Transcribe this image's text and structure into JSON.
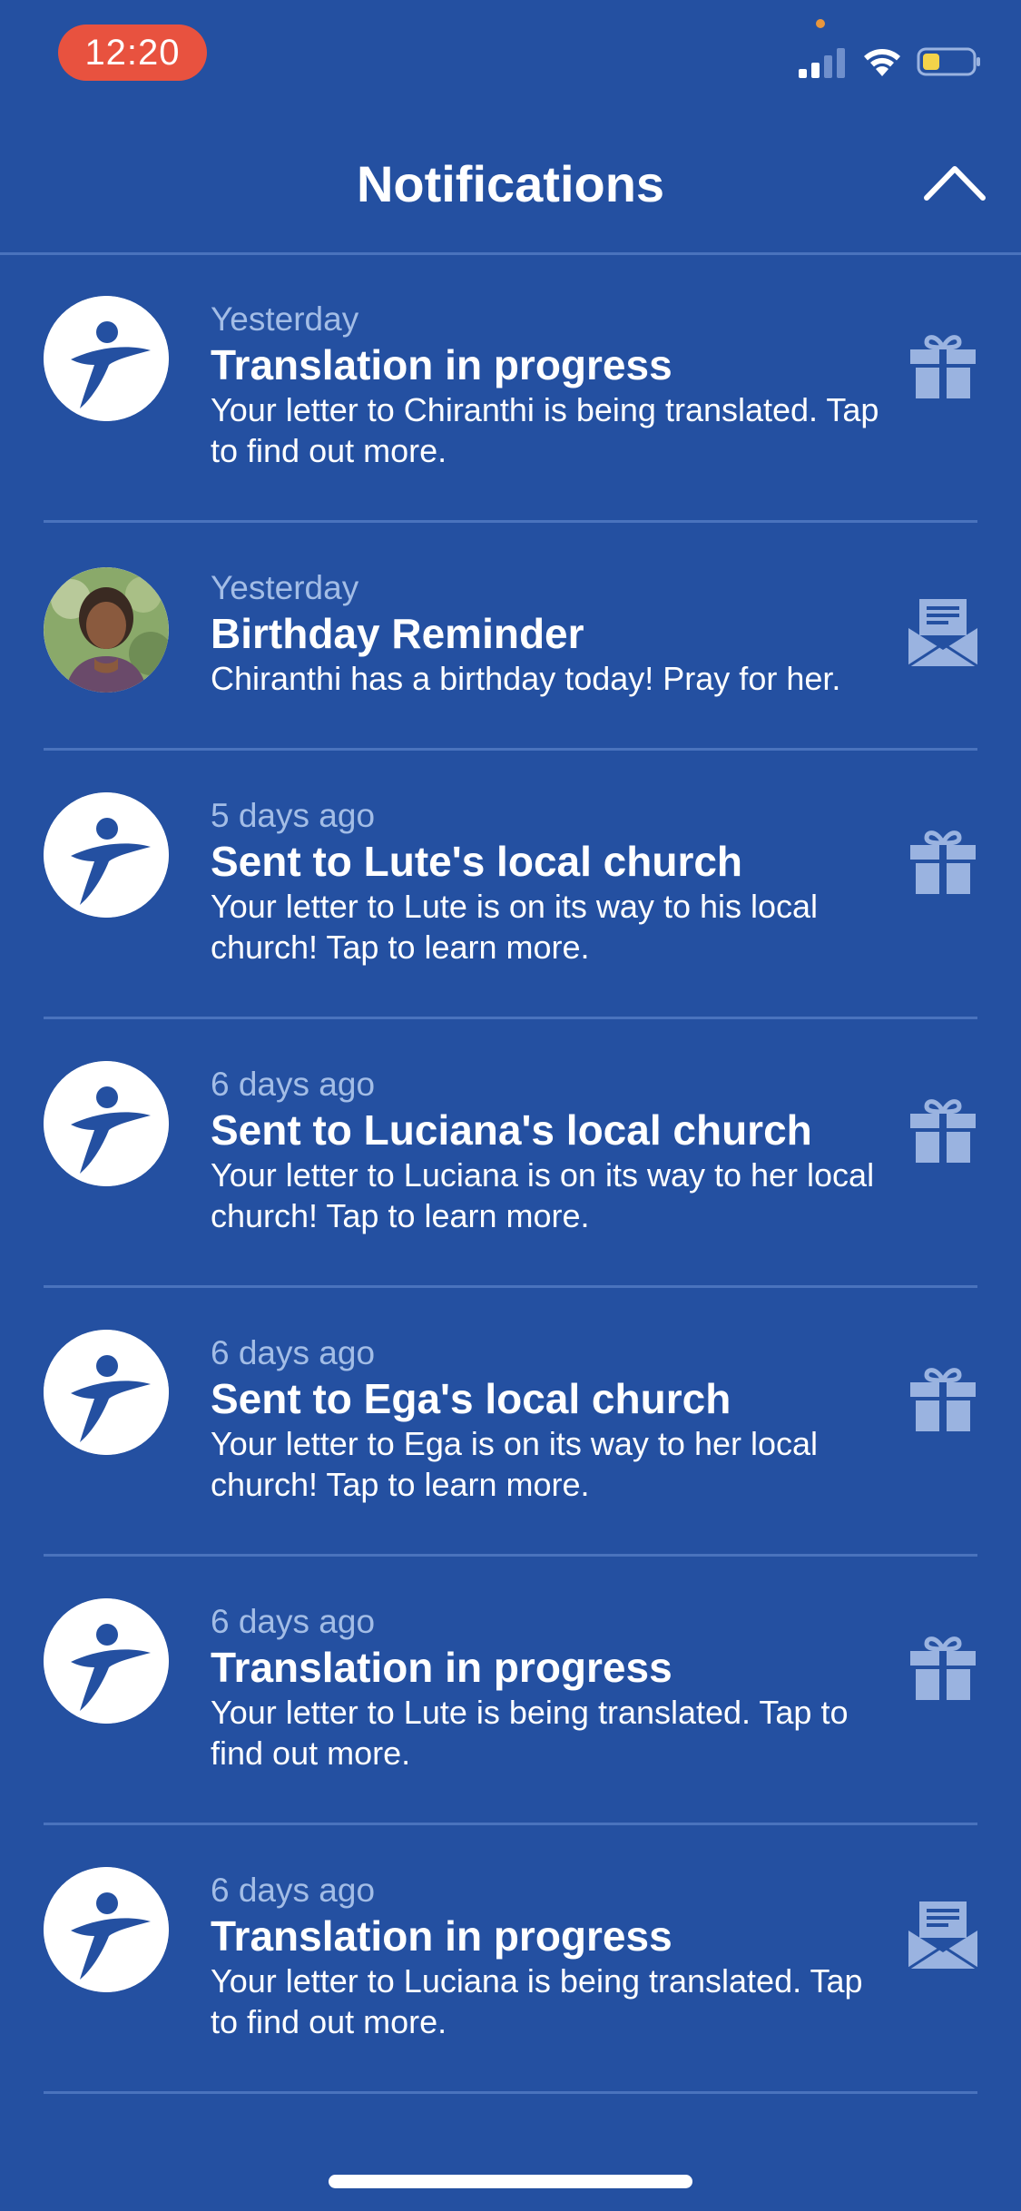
{
  "status_bar": {
    "time": "12:20",
    "icons": [
      "signal-icon",
      "wifi-icon",
      "battery-icon"
    ],
    "battery_color": "#f3d34a",
    "time_pill_color": "#e8523f"
  },
  "header": {
    "title": "Notifications",
    "collapse_icon": "chevron-up-icon"
  },
  "colors": {
    "background": "#2450a1",
    "divider": "#4a73bd",
    "time_text": "#a3bde6",
    "type_icon": "#9ab3e0"
  },
  "notifications": [
    {
      "time": "Yesterday",
      "title": "Translation in progress",
      "body": "Your letter to Chiranthi is being translated. Tap to find out more.",
      "avatar": "logo-icon",
      "type_icon": "gift-icon"
    },
    {
      "time": "Yesterday",
      "title": "Birthday Reminder",
      "body": "Chiranthi has a birthday today! Pray for her.",
      "avatar": "child-photo",
      "type_icon": "envelope-icon"
    },
    {
      "time": "5 days ago",
      "title": "Sent to Lute's local church",
      "body": "Your letter to Lute is on its way to his local church! Tap to learn more.",
      "avatar": "logo-icon",
      "type_icon": "gift-icon"
    },
    {
      "time": "6 days ago",
      "title": "Sent to Luciana's local church",
      "body": "Your letter to Luciana is on its way to her local church! Tap to learn more.",
      "avatar": "logo-icon",
      "type_icon": "gift-icon"
    },
    {
      "time": "6 days ago",
      "title": "Sent to Ega's local church",
      "body": "Your letter to Ega is on its way to her local church! Tap to learn more.",
      "avatar": "logo-icon",
      "type_icon": "gift-icon"
    },
    {
      "time": "6 days ago",
      "title": "Translation in progress",
      "body": "Your letter to Lute is being translated. Tap to find out more.",
      "avatar": "logo-icon",
      "type_icon": "gift-icon"
    },
    {
      "time": "6 days ago",
      "title": "Translation in progress",
      "body": "Your letter to Luciana is being translated. Tap to find out more.",
      "avatar": "logo-icon",
      "type_icon": "envelope-icon"
    }
  ]
}
